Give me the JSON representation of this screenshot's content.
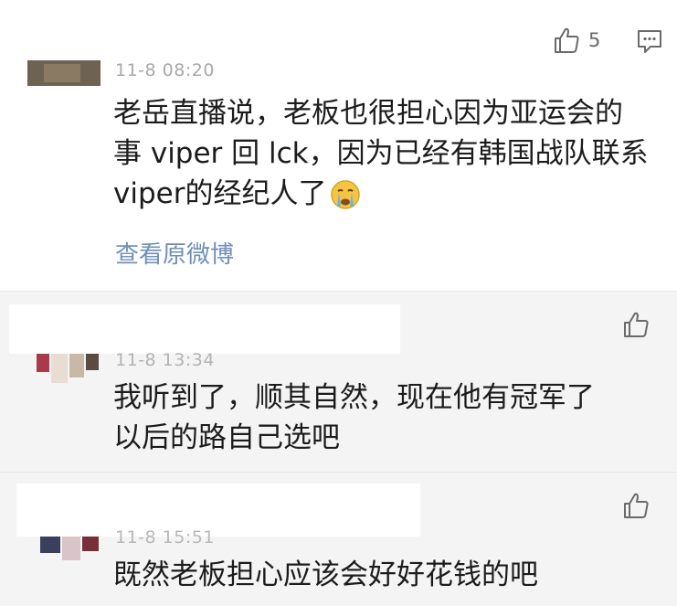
{
  "comments": [
    {
      "time": "11-8 08:20",
      "lines": [
        "老岳直播说，老板也很担心因为亚运会的",
        "事 viper 回 lck，因为已经有韩国战队联系",
        "viper的经纪人了"
      ],
      "emoji": "crying-face",
      "likes": "5",
      "link": "查看原微博"
    },
    {
      "time": "11-8 13:34",
      "lines": [
        "我听到了，顺其自然，现在他有冠军了",
        "以后的路自己选吧"
      ]
    },
    {
      "time": "11-8 15:51",
      "lines": [
        "既然老板担心应该会好好花钱的吧"
      ]
    }
  ],
  "icons": {
    "like": "thumbs-up-icon",
    "reply": "comment-icon"
  },
  "colors": {
    "link": "#6f8fb8",
    "timestamp": "#a9a9a9",
    "text": "#1c1c1c",
    "icon": "#6a6a6a"
  }
}
